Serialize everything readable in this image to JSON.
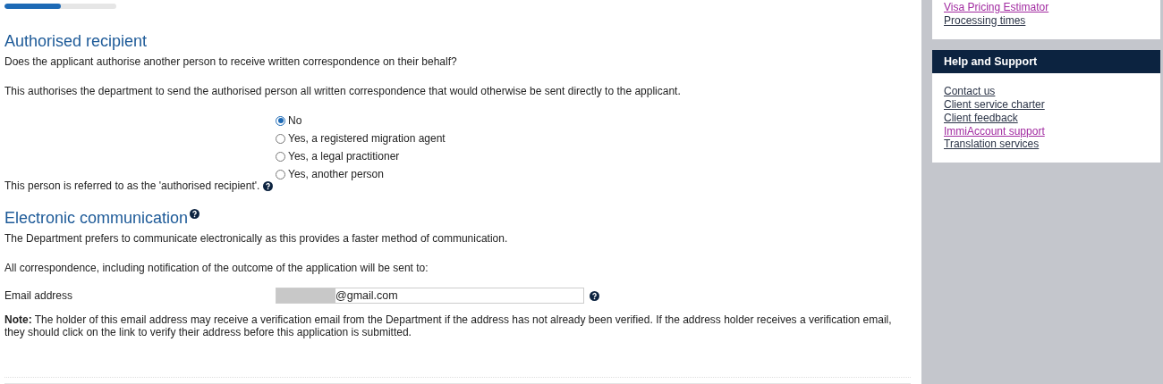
{
  "progress": {
    "level": 0.5
  },
  "authorised_recipient": {
    "heading": "Authorised recipient",
    "question": "Does the applicant authorise another person to receive written correspondence on their behalf?",
    "explanation": "This authorises the department to send the authorised person all written correspondence that would otherwise be sent directly to the applicant.",
    "options": [
      {
        "label": "No",
        "selected": true
      },
      {
        "label": "Yes, a registered migration agent",
        "selected": false
      },
      {
        "label": "Yes, a legal practitioner",
        "selected": false
      },
      {
        "label": "Yes, another person",
        "selected": false
      }
    ],
    "footnote": "This person is referred to as the 'authorised recipient'."
  },
  "electronic_communication": {
    "heading": "Electronic communication",
    "intro": "The Department prefers to communicate electronically as this provides a faster method of communication.",
    "correspondence": "All correspondence, including notification of the outcome of the application will be sent to:",
    "email_label": "Email address",
    "email_value": "@gmail.com",
    "note": "**Note:** The holder of this email address may receive a verification email from the Department if the address has not already been verified. If the address holder receives a verification email, they should click on the link to verify their address before this application is submitted."
  },
  "sidebar": {
    "top_links": [
      {
        "label": "Visa Pricing Estimator",
        "visited": true
      },
      {
        "label": "Processing times",
        "visited": false
      }
    ],
    "help_title": "Help and Support",
    "help_links": [
      {
        "label": "Contact us",
        "visited": false
      },
      {
        "label": "Client service charter",
        "visited": false
      },
      {
        "label": "Client feedback",
        "visited": false
      },
      {
        "label": "ImmiAccount support",
        "visited": true
      },
      {
        "label": "Translation services",
        "visited": false
      }
    ]
  }
}
